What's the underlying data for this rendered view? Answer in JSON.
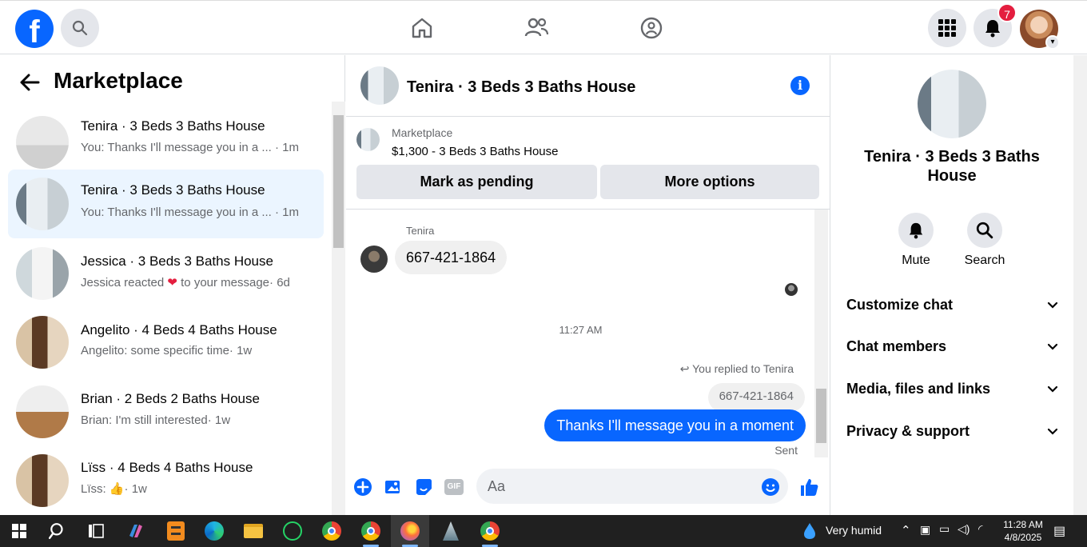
{
  "topnav": {
    "logo": "f",
    "notifications_count": "7",
    "colors": {
      "brand": "#0866ff",
      "badge": "#e41e3f"
    }
  },
  "sidebar": {
    "title": "Marketplace",
    "conversations": [
      {
        "title": "Tenira · 3 Beds 3 Baths House",
        "preview": "You: Thanks I'll message you in a ...",
        "time": "· 1m",
        "active": false
      },
      {
        "title": "Tenira · 3 Beds 3 Baths House",
        "preview": "You: Thanks I'll message you in a ...",
        "time": "· 1m",
        "active": true
      },
      {
        "title": "Jessica · 3 Beds 3 Baths House",
        "preview": "Jessica reacted",
        "preview_tail": "to your message",
        "time": "· 6d",
        "active": false
      },
      {
        "title": "Angelito · 4 Beds 4 Baths House",
        "preview": "Angelito: some specific time",
        "time": "· 1w",
        "active": false
      },
      {
        "title": "Brian · 2 Beds 2 Baths House",
        "preview": "Brian: I'm still interested",
        "time": "· 1w",
        "active": false
      },
      {
        "title": "Lïss · 4 Beds 4 Baths House",
        "preview": "Lïss:",
        "time": "· 1w",
        "active": false
      }
    ]
  },
  "chat": {
    "header_title": "Tenira · 3 Beds 3 Baths House",
    "listing": {
      "label": "Marketplace",
      "price_title": "$1,300 - 3 Beds 3 Baths House",
      "pending_button": "Mark as pending",
      "more_button": "More options"
    },
    "messages": {
      "sender_name": "Tenira",
      "incoming": "667-421-1864",
      "timestamp": "11:27 AM",
      "replied_label": "You replied to Tenira",
      "quoted": "667-421-1864",
      "outgoing": "Thanks I'll message you in a moment",
      "status": "Sent"
    },
    "composer": {
      "placeholder": "Aa",
      "gif_label": "GIF"
    }
  },
  "right_panel": {
    "name": "Tenira · 3 Beds 3 Baths House",
    "actions": [
      {
        "label": "Mute"
      },
      {
        "label": "Search"
      }
    ],
    "sections": [
      {
        "label": "Customize chat"
      },
      {
        "label": "Chat members"
      },
      {
        "label": "Media, files and links"
      },
      {
        "label": "Privacy & support"
      }
    ]
  },
  "taskbar": {
    "weather": "Very humid",
    "time": "11:28 AM",
    "date": "4/8/2025"
  }
}
